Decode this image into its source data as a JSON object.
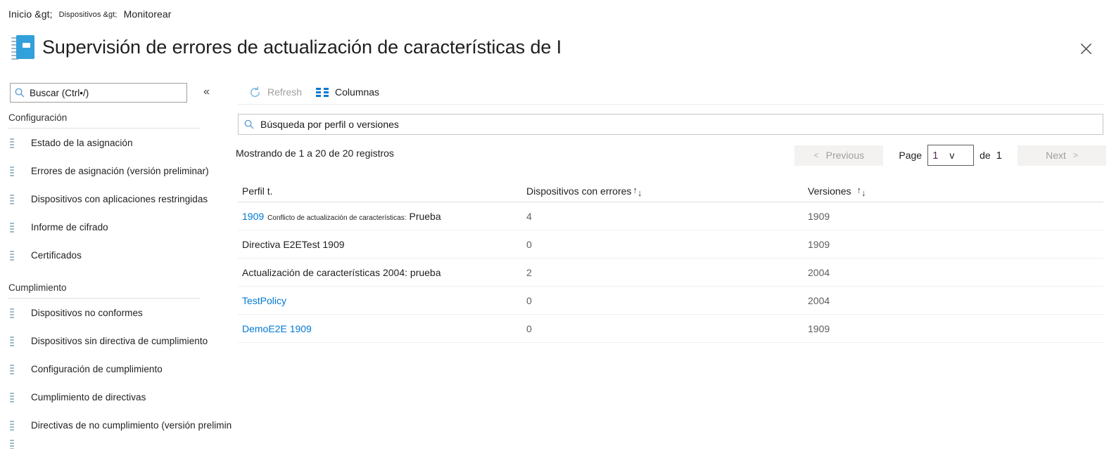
{
  "breadcrumb": {
    "segments": [
      "Inicio &gt;",
      "Dispositivos &gt;",
      "Monitorear"
    ]
  },
  "header": {
    "title": "Supervisión de errores de actualización de características de I",
    "icon": "notebook-report-icon",
    "close_label": "Cerrar"
  },
  "sidebar": {
    "search": {
      "placeholder": "Buscar (Ctrl•/)",
      "icon": "search-icon"
    },
    "collapse_icon": "chevron-double-left-icon",
    "groups": [
      {
        "title": "Configuración",
        "items": [
          {
            "label": "Estado de la asignación",
            "icon": "notebook-report-icon"
          },
          {
            "label": "Errores de asignación (versión preliminar)",
            "icon": "notebook-report-icon"
          },
          {
            "label": "Dispositivos con aplicaciones restringidas",
            "icon": "notebook-report-icon"
          },
          {
            "label": "Informe de cifrado",
            "icon": "notebook-report-icon"
          },
          {
            "label": "Certificados",
            "icon": "notebook-report-icon"
          }
        ]
      },
      {
        "title": "Cumplimiento",
        "items": [
          {
            "label": "Dispositivos no conformes",
            "icon": "notebook-report-icon"
          },
          {
            "label": "Dispositivos sin directiva de cumplimiento",
            "icon": "notebook-report-icon"
          },
          {
            "label": "Configuración de cumplimiento",
            "icon": "notebook-report-icon"
          },
          {
            "label": "Cumplimiento de directivas",
            "icon": "notebook-report-icon"
          },
          {
            "label": "Directivas de no cumplimiento (versión preliminar)",
            "icon": "notebook-report-icon"
          }
        ]
      }
    ]
  },
  "toolbar": {
    "refresh_label": "Refresh",
    "refresh_icon": "refresh-icon",
    "columns_label": "Columnas",
    "columns_icon": "columns-icon"
  },
  "search": {
    "placeholder": "Búsqueda por perfil o versiones",
    "icon": "search-icon"
  },
  "records": {
    "summary": "Mostrando de 1 a 20 de 20 registros"
  },
  "pager": {
    "previous_label": "Previous",
    "previous_caret": "<",
    "page_label": "Page",
    "page_value": "1",
    "page_select_caret": "v",
    "of_label": "de",
    "total_pages": "1",
    "next_label": "Next",
    "next_caret": ">"
  },
  "table": {
    "columns": [
      {
        "label": "Perfil t.",
        "sortable": false
      },
      {
        "label": "Dispositivos con errores",
        "sortable": true
      },
      {
        "label": "Versiones",
        "sortable": true
      }
    ],
    "sort_up": "↑",
    "sort_down": "↓",
    "rows": [
      {
        "profile_link": "1909",
        "profile_small": "Conflicto de actualización de características:",
        "profile_after": "Prueba",
        "errors": "4",
        "version": "1909"
      },
      {
        "profile_plain": "Directiva E2ETest 1909",
        "errors": "0",
        "version": "1909"
      },
      {
        "profile_plain": "Actualización de características 2004: prueba",
        "errors": "2",
        "version": "2004"
      },
      {
        "profile_link": "TestPolicy",
        "errors": "0",
        "version": "2004"
      },
      {
        "profile_link": "DemoE2E 1909",
        "errors": "0",
        "version": "1909"
      }
    ]
  },
  "colors": {
    "link": "#0078d4",
    "accent": "#32a0da",
    "text": "#201f1e",
    "muted": "#605e5c"
  }
}
